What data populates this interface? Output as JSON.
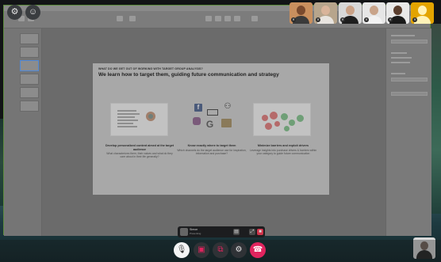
{
  "slide": {
    "kicker": "WHAT DO WE GET OUT OF WORKING WITH TARGET GROUP ANALYSIS?",
    "headline": "We learn how to target them, guiding future communication and strategy",
    "columns": [
      {
        "title": "Develop personalized content aimed at the target audience",
        "body": "What characterizes them, their values and what do they care about in their life generally?"
      },
      {
        "title": "Know exactly where to target them",
        "body": "Which channels do the target audience use for inspiration, information and purchase?"
      },
      {
        "title": "Minimize barriers and exploit drivers",
        "body": "Leverage insights into purchase drivers & barriers within your category to guide future communication"
      }
    ]
  },
  "presenter_bar": {
    "name": "Simon",
    "subtitle": "Presenting"
  },
  "toolbar_icons": [
    "settings-icon",
    "add-person-icon"
  ],
  "controls": [
    {
      "name": "microphone-button",
      "icon": "mic-icon",
      "glyph": "🎙"
    },
    {
      "name": "camera-button",
      "icon": "camera-off-icon",
      "glyph": "▣"
    },
    {
      "name": "share-screen-button",
      "icon": "share-screen-icon",
      "glyph": "⧉"
    },
    {
      "name": "settings-button",
      "icon": "gear-icon",
      "glyph": "⚙"
    },
    {
      "name": "leave-call-button",
      "icon": "phone-hangup-icon",
      "glyph": "☎"
    }
  ],
  "colors": {
    "accent_green": "#5b8a3c",
    "leave_red": "#e0245e",
    "selected_blue": "#4f88d6"
  }
}
